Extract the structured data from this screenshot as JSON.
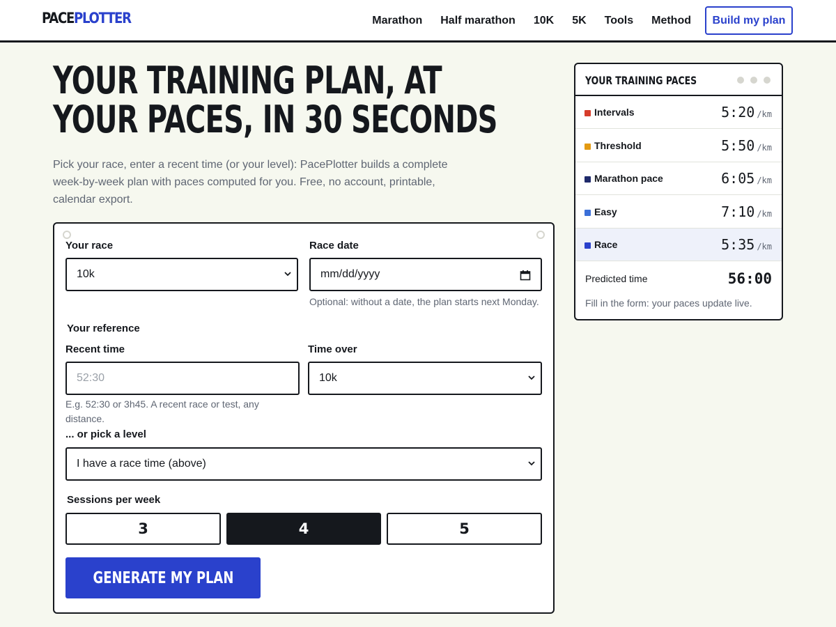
{
  "header": {
    "logo_part1": "PACE",
    "logo_part2": "PLOTTER",
    "nav": [
      "Marathon",
      "Half marathon",
      "10K",
      "5K",
      "Tools",
      "Method"
    ],
    "cta": "Build my plan"
  },
  "hero": {
    "title_line1": "YOUR TRAINING PLAN, AT",
    "title_line2": "YOUR PACES, IN 30 SECONDS",
    "lead": "Pick your race, enter a recent time (or your level): PacePlotter builds a complete week-by-week plan with paces computed for you. Free, no account, printable, calendar export."
  },
  "form": {
    "race_label": "Your race",
    "race_value": "10k",
    "date_label": "Race date",
    "date_placeholder": "mm/dd/yyyy",
    "date_hint": "Optional: without a date, the plan starts next Monday.",
    "reference_heading": "Your reference",
    "recent_label": "Recent time",
    "recent_placeholder": "52:30",
    "recent_hint": "E.g. 52:30 or 3h45. A recent race or test, any distance.",
    "over_label": "Time over",
    "over_value": "10k",
    "level_label": "... or pick a level",
    "level_value": "I have a race time (above)",
    "sessions_label": "Sessions per week",
    "sessions": [
      "3",
      "4",
      "5"
    ],
    "sessions_selected": "4",
    "submit": "GENERATE MY PLAN"
  },
  "paces_card": {
    "title": "YOUR TRAINING PACES",
    "unit": "/km",
    "rows": [
      {
        "name": "Intervals",
        "pace": "5:20",
        "color": "#d63c2a"
      },
      {
        "name": "Threshold",
        "pace": "5:50",
        "color": "#e39a12"
      },
      {
        "name": "Marathon pace",
        "pace": "6:05",
        "color": "#1f2a6b"
      },
      {
        "name": "Easy",
        "pace": "7:10",
        "color": "#3b6fd8"
      },
      {
        "name": "Race",
        "pace": "5:35",
        "color": "#2a41cc"
      }
    ],
    "predicted_label": "Predicted time",
    "predicted_value": "56:00",
    "footer": "Fill in the form: your paces update live."
  },
  "colors": {
    "accent": "#2a41cc",
    "ink": "#15181d",
    "background": "#f6f8ef"
  },
  "icons": {
    "select_arrow": "chevron-down-icon",
    "date_picker": "calendar-icon"
  }
}
